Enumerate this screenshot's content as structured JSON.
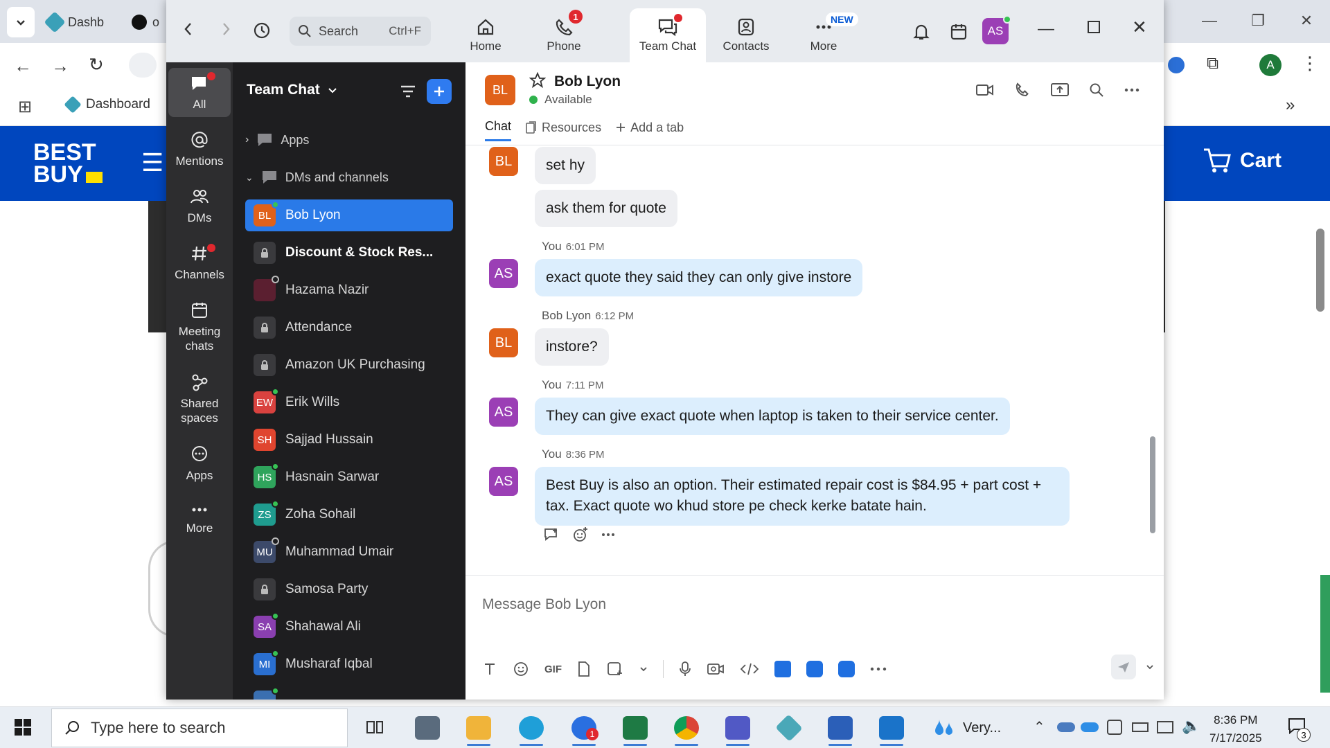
{
  "browser": {
    "tab1_label": "Dashb",
    "tab2_label": "o",
    "bookmark_label": "Dashboard",
    "profile_initial": "A",
    "page": {
      "cart_label": "Cart",
      "logo_line1": "BEST",
      "logo_line2": "BUY"
    }
  },
  "zoom": {
    "search": {
      "placeholder": "Search",
      "shortcut": "Ctrl+F"
    },
    "nav": [
      {
        "label": "Home"
      },
      {
        "label": "Phone",
        "badge": "1"
      },
      {
        "label": "Team Chat"
      },
      {
        "label": "Contacts"
      },
      {
        "label": "More",
        "badge": "NEW"
      }
    ],
    "user_initials": "AS",
    "rail": [
      {
        "label": "All"
      },
      {
        "label": "Mentions"
      },
      {
        "label": "DMs"
      },
      {
        "label": "Channels"
      },
      {
        "label": "Meeting chats"
      },
      {
        "label": "Shared spaces"
      },
      {
        "label": "Apps"
      },
      {
        "label": "More"
      }
    ],
    "channel_list": {
      "title": "Team Chat",
      "groups": [
        {
          "label": "Apps"
        },
        {
          "label": "DMs and channels"
        }
      ],
      "items": [
        {
          "initials": "BL",
          "name": "Bob Lyon",
          "color": "#e0611a"
        },
        {
          "initials": "",
          "name": "Discount & Stock Res...",
          "color": "#3a3a3d"
        },
        {
          "initials": "",
          "name": "Hazama Nazir",
          "color": "#6a2a3a"
        },
        {
          "initials": "",
          "name": "Attendance",
          "color": "#3a3a3d"
        },
        {
          "initials": "",
          "name": "Amazon UK Purchasing",
          "color": "#3a3a3d"
        },
        {
          "initials": "EW",
          "name": "Erik Wills",
          "color": "#d9423f"
        },
        {
          "initials": "SH",
          "name": "Sajjad Hussain",
          "color": "#e0452f"
        },
        {
          "initials": "HS",
          "name": "Hasnain Sarwar",
          "color": "#2fa45c"
        },
        {
          "initials": "ZS",
          "name": "Zoha Sohail",
          "color": "#1f9c8f"
        },
        {
          "initials": "MU",
          "name": "Muhammad Umair",
          "color": "#3c4a6a"
        },
        {
          "initials": "",
          "name": "Samosa Party",
          "color": "#3a3a3d"
        },
        {
          "initials": "SA",
          "name": "Shahawal Ali",
          "color": "#8a3fb0"
        },
        {
          "initials": "MI",
          "name": "Musharaf Iqbal",
          "color": "#2a6fd0"
        }
      ]
    },
    "chat": {
      "contact_initials": "BL",
      "contact_name": "Bob Lyon",
      "contact_status": "Available",
      "tabs": [
        {
          "label": "Chat"
        },
        {
          "label": "Resources"
        },
        {
          "label": "Add a tab"
        }
      ],
      "messages": [
        {
          "sender": "",
          "initials": "BL",
          "time": "",
          "text": "set hy"
        },
        {
          "sender": "",
          "initials": "",
          "time": "",
          "text": "ask them for quote"
        },
        {
          "sender": "You",
          "initials": "AS",
          "time": "6:01 PM",
          "text": "exact quote they said they can only give instore"
        },
        {
          "sender": "Bob Lyon",
          "initials": "BL",
          "time": "6:12 PM",
          "text": "instore?"
        },
        {
          "sender": "You",
          "initials": "AS",
          "time": "7:11 PM",
          "text": "They can give exact quote when laptop is taken to their service center."
        },
        {
          "sender": "You",
          "initials": "AS",
          "time": "8:36 PM",
          "text": "Best Buy is also an option. Their estimated repair cost is $84.95 + part cost + tax. Exact quote wo khud store pe check kerke batate hain."
        }
      ],
      "composer_placeholder": "Message Bob Lyon",
      "gif_label": "GIF"
    }
  },
  "taskbar": {
    "search_placeholder": "Type here to search",
    "weather_label": "Very...",
    "time": "8:36 PM",
    "date": "7/17/2025",
    "notification_count": "3",
    "zoom_badge": "1"
  }
}
